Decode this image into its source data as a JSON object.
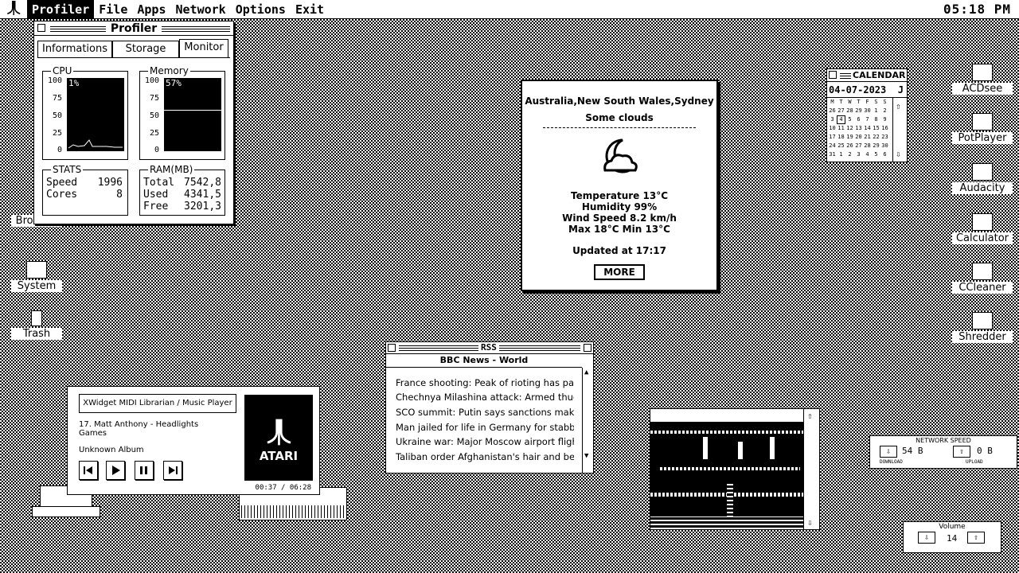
{
  "menubar": {
    "logo": "atari-logo",
    "items": [
      "Profiler",
      "File",
      "Apps",
      "Network",
      "Options",
      "Exit"
    ],
    "active": "Profiler",
    "clock": "05:18 PM"
  },
  "desktop_icons_left": [
    {
      "label": "Browser",
      "icon": "browser-icon"
    },
    {
      "label": "System",
      "icon": "system-icon"
    },
    {
      "label": "Trash",
      "icon": "trash-icon"
    }
  ],
  "desktop_icons_right": [
    {
      "label": "ACDsee",
      "icon": "acdsee-icon"
    },
    {
      "label": "PotPlayer",
      "icon": "potplayer-icon"
    },
    {
      "label": "Audacity",
      "icon": "audacity-icon"
    },
    {
      "label": "Calculator",
      "icon": "calculator-icon"
    },
    {
      "label": "CCleaner",
      "icon": "ccleaner-icon"
    },
    {
      "label": "Shredder",
      "icon": "shredder-icon"
    }
  ],
  "profiler": {
    "title": "Profiler",
    "tabs": [
      "Informations",
      "Storage",
      "Monitor"
    ],
    "selected_tab": "Monitor",
    "cpu": {
      "label": "CPU",
      "percent": "1%",
      "value": 1,
      "ticks": [
        "100",
        "75",
        "50",
        "25",
        "0"
      ]
    },
    "memory": {
      "label": "Memory",
      "percent": "57%",
      "value": 57,
      "ticks": [
        "100",
        "75",
        "50",
        "25",
        "0"
      ]
    },
    "stats": {
      "label": "STATS",
      "speed_k": "Speed",
      "speed_v": "1996",
      "cores_k": "Cores",
      "cores_v": "8"
    },
    "ram": {
      "label": "RAM(MB)",
      "total_k": "Total",
      "total_v": "7542,8",
      "used_k": "Used",
      "used_v": "4341,5",
      "free_k": "Free",
      "free_v": "3201,3"
    }
  },
  "weather": {
    "location": "Australia,New South Wales,Sydney",
    "condition": "Some clouds",
    "icon": "cloud-moon-icon",
    "temperature": "Temperature 13°C",
    "humidity": "Humidity 99%",
    "wind": "Wind Speed 8.2 km/h",
    "maxmin": "Max 18°C Min 13°C",
    "updated": "Updated at 17:17",
    "more": "MORE"
  },
  "calendar": {
    "title": "CALENDAR",
    "date": "04-07-2023",
    "month_letter": "J",
    "weekdays": [
      "M",
      "T",
      "W",
      "T",
      "F",
      "S",
      "S"
    ],
    "weeks": [
      [
        "26",
        "27",
        "28",
        "29",
        "30",
        "1",
        "2"
      ],
      [
        "3",
        "4",
        "5",
        "6",
        "7",
        "8",
        "9"
      ],
      [
        "10",
        "11",
        "12",
        "13",
        "14",
        "15",
        "16"
      ],
      [
        "17",
        "18",
        "19",
        "20",
        "21",
        "22",
        "23"
      ],
      [
        "24",
        "25",
        "26",
        "27",
        "28",
        "29",
        "30"
      ],
      [
        "31",
        "1",
        "2",
        "3",
        "4",
        "5",
        "6"
      ]
    ],
    "today": "4"
  },
  "rss": {
    "title": "RSS",
    "feed": "BBC News - World",
    "items": [
      "France shooting: Peak of rioting has pa...",
      "Chechnya Milashina attack: Armed thug...",
      "SCO summit: Putin says sanctions makin...",
      "Man jailed for life in Germany for stabbi...",
      "Ukraine war: Major Moscow airport fligh...",
      "Taliban order Afghanistan's hair and be..."
    ]
  },
  "player": {
    "header": "XWidget MIDI Librarian / Music Player",
    "track": "17. Matt Anthony - Headlights",
    "artist": "Games",
    "album": "Unknown Album",
    "art_text": "ATARI",
    "time": "00:37 / 06:28",
    "buttons": [
      "prev-icon",
      "play-icon",
      "pause-icon",
      "next-icon"
    ]
  },
  "network": {
    "title": "NETWORK SPEED",
    "download_value": "54 B",
    "download_label": "DOWNLOAD",
    "upload_value": "0 B",
    "upload_label": "UPLOAD"
  },
  "volume": {
    "title": "Volume",
    "value": "14"
  }
}
